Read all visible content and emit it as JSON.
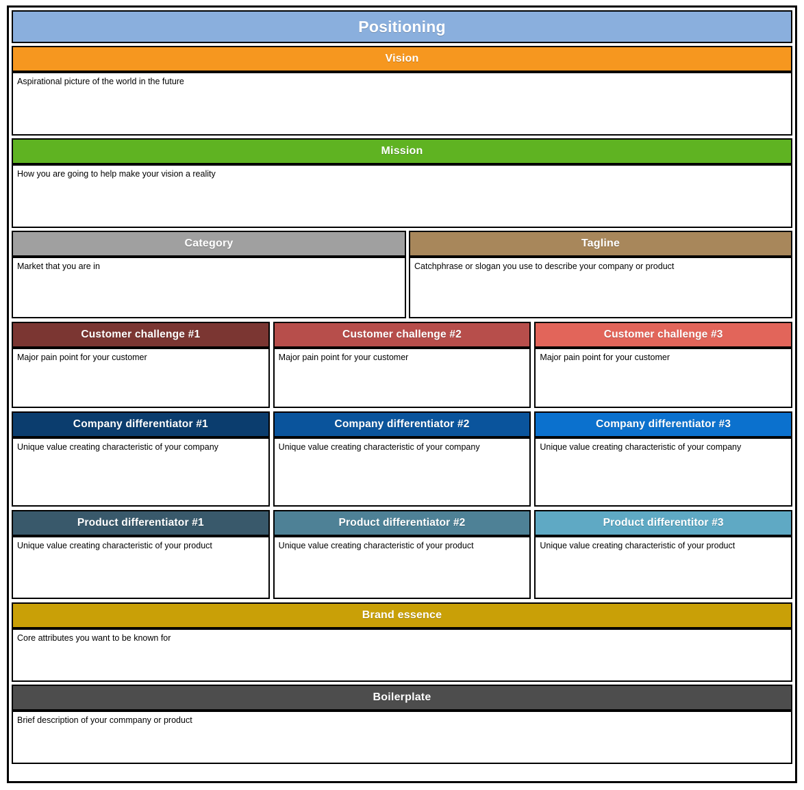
{
  "document": {
    "title": "Positioning",
    "title_color": "#8AAFDD"
  },
  "sections": {
    "vision": {
      "label": "Vision",
      "color": "#F6971F",
      "body": "Aspirational picture of the world in the future"
    },
    "mission": {
      "label": "Mission",
      "color": "#5FB322",
      "body": "How you are going to help make your vision a reality"
    },
    "category": {
      "label": "Category",
      "color": "#A0A0A0",
      "body": "Market that you are in"
    },
    "tagline": {
      "label": "Tagline",
      "color": "#A8875B",
      "body": "Catchphrase or slogan you use to describe your company or product"
    },
    "brand_essence": {
      "label": "Brand essence",
      "color": "#C9A007",
      "body": "Core attributes you want to be known for"
    },
    "boilerplate": {
      "label": "Boilerplate",
      "color": "#4D4D4D",
      "body": "Brief description of your commpany or product"
    }
  },
  "customer_challenges": [
    {
      "label": "Customer challenge #1",
      "color": "#7B3632",
      "body": "Major pain point for your customer"
    },
    {
      "label": "Customer challenge #2",
      "color": "#B74E4B",
      "body": "Major pain point for your customer"
    },
    {
      "label": "Customer challenge #3",
      "color": "#E2655A",
      "body": "Major pain point for your customer"
    }
  ],
  "company_differentiators": [
    {
      "label": "Company differentiator #1",
      "color": "#0B3D6E",
      "body": "Unique value creating characteristic of your company"
    },
    {
      "label": "Company differentiator #2",
      "color": "#0A549C",
      "body": "Unique value creating characteristic of your company"
    },
    {
      "label": "Company differentiator #3",
      "color": "#0B71CE",
      "body": "Unique value creating characteristic of your company"
    }
  ],
  "product_differentiators": [
    {
      "label": "Product differentiator #1",
      "color": "#39596B",
      "body": "Unique value creating characteristic of your product"
    },
    {
      "label": "Product differentiator #2",
      "color": "#4E8196",
      "body": "Unique value creating characteristic of your product"
    },
    {
      "label": "Product differentitor #3",
      "color": "#5FA9C4",
      "body": "Unique value creating characteristic of your product"
    }
  ]
}
